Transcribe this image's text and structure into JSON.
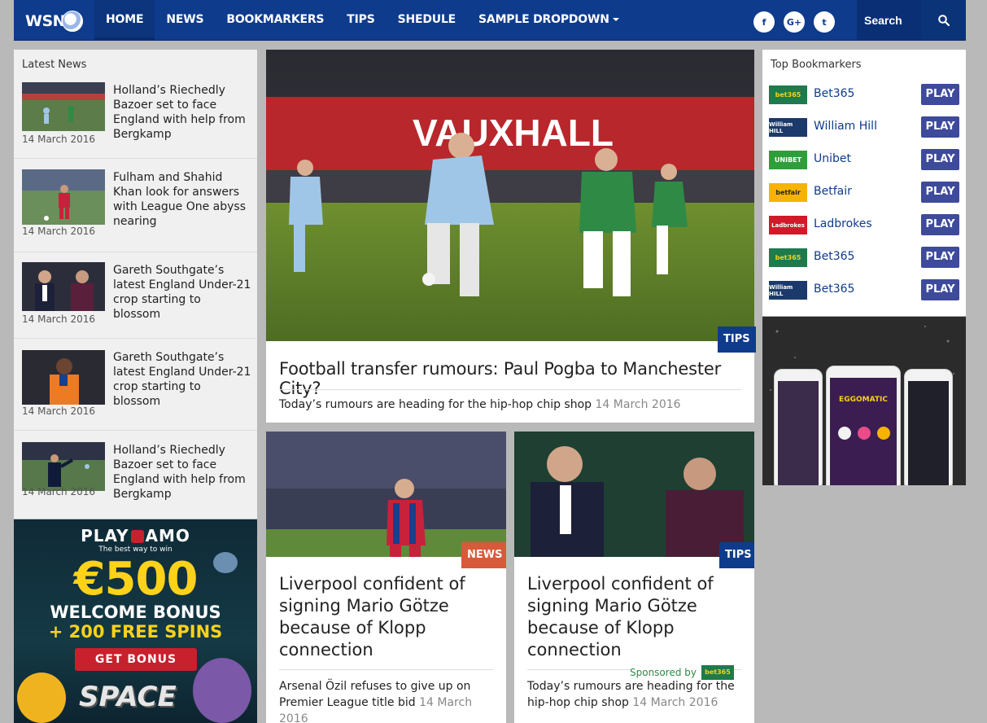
{
  "brand": {
    "logo_text": "WSN"
  },
  "nav": {
    "items": [
      "HOME",
      "NEWS",
      "BOOKMARKERS",
      "TIPS",
      "SHEDULE",
      "SAMPLE DROPDOWN"
    ],
    "active": "HOME"
  },
  "social": {
    "facebook": "f",
    "google": "G+",
    "twitter": "t"
  },
  "search": {
    "placeholder": "Search"
  },
  "latest_news": {
    "title": "Latest News",
    "items": [
      {
        "title": "Holland’s Riechedly Bazoer set to face England with help from Bergkamp",
        "date": "14 March 2016"
      },
      {
        "title": "Fulham and Shahid Khan look for answers with League One abyss nearing",
        "date": "14 March 2016"
      },
      {
        "title": "Gareth Southgate’s latest England Under-21 crop starting to blossom",
        "date": "14 March 2016"
      },
      {
        "title": "Gareth Southgate’s latest England Under-21 crop starting to blossom",
        "date": "14 March 2016"
      },
      {
        "title": "Holland’s Riechedly Bazoer set to face England with help from Bergkamp",
        "date": "14 March 2016"
      }
    ]
  },
  "ad_left": {
    "brand": "PLAY AMO",
    "brand_left": "PLAY",
    "brand_right": "AMO",
    "tagline": "The best way to win",
    "amount": "€500",
    "bonus": "WELCOME BONUS",
    "spins": "+ 200 FREE SPINS",
    "cta": "GET BONUS",
    "game": "SPACE"
  },
  "feature": {
    "label": "TIPS",
    "title": "Football transfer rumours: Paul Pogba to Manchester City?",
    "subtitle": "Today’s rumours are heading for the hip-hop chip shop",
    "date": "14 March 2016",
    "banner_text": "VAUXHALL"
  },
  "cards": [
    {
      "label": "NEWS",
      "title": "Liverpool confident of signing Mario Götze because of Klopp connection",
      "subtitle": "Arsenal Özil refuses to give up on Premier League title bid",
      "date": "14 March 2016"
    },
    {
      "label": "TIPS",
      "title": "Liverpool confident of signing Mario Götze because of Klopp connection",
      "sponsored_text": "Sponsored by",
      "sponsor": "bet365",
      "subtitle": "Today’s rumours are heading for the hip-hop chip shop",
      "date": "14 March 2016"
    }
  ],
  "bookmakers": {
    "title": "Top Bookmarkers",
    "play_label": "PLAY",
    "items": [
      {
        "name": "Bet365",
        "logo": "bet365",
        "color": "#1f7a4c"
      },
      {
        "name": "William Hill",
        "logo": "William HILL",
        "color": "#1b3a6b"
      },
      {
        "name": "Unibet",
        "logo": "UNIBET",
        "color": "#2f9e3a"
      },
      {
        "name": "Betfair",
        "logo": "betfair",
        "color": "#f6b400"
      },
      {
        "name": "Ladbrokes",
        "logo": "Ladbrokes",
        "color": "#d1192a"
      },
      {
        "name": "Bet365",
        "logo": "bet365",
        "color": "#1f7a4c"
      },
      {
        "name": "Bet365",
        "logo": "William HILL",
        "color": "#1b3a6b"
      }
    ]
  },
  "app_ad": {
    "game": "EGGOMATIC"
  }
}
